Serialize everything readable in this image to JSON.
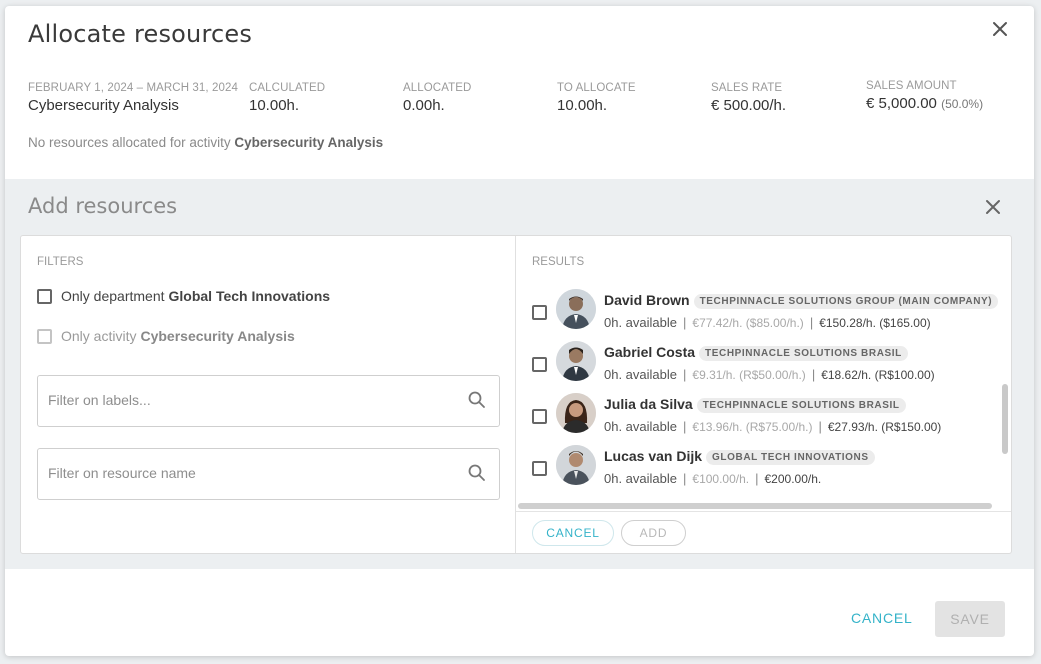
{
  "dialog": {
    "title": "Allocate resources",
    "summary": {
      "period": {
        "label": "FEBRUARY 1, 2024 – MARCH 31, 2024",
        "value": "Cybersecurity Analysis"
      },
      "calculated": {
        "label": "CALCULATED",
        "value": "10.00h."
      },
      "allocated": {
        "label": "ALLOCATED",
        "value": "0.00h."
      },
      "to_allocate": {
        "label": "TO ALLOCATE",
        "value": "10.00h."
      },
      "sales_rate": {
        "label": "SALES RATE",
        "value": "€ 500.00/h."
      },
      "sales_amount": {
        "label": "SALES AMOUNT",
        "value": "€ 5,000.00",
        "pct": "(50.0%)"
      }
    },
    "no_resources_prefix": "No resources allocated for activity",
    "no_resources_activity": "Cybersecurity Analysis",
    "footer": {
      "cancel_label": "CANCEL",
      "save_label": "SAVE"
    }
  },
  "add_resources": {
    "title": "Add resources",
    "filters": {
      "label": "FILTERS",
      "only_department": {
        "prefix": "Only department",
        "value": "Global Tech Innovations",
        "checked": false
      },
      "only_activity": {
        "prefix": "Only activity",
        "value": "Cybersecurity Analysis",
        "checked": false,
        "disabled": true
      },
      "labels_placeholder": "Filter on labels...",
      "name_placeholder": "Filter on resource name"
    },
    "results": {
      "label": "RESULTS",
      "items": [
        {
          "name": "David Brown",
          "company": "TECHPINNACLE SOLUTIONS GROUP (MAIN COMPANY)",
          "available": "0h. available",
          "cost": "€77.42/h. ($85.00/h.)",
          "price": "€150.28/h. ($165.00)",
          "avatar_color": "#5a6b7a"
        },
        {
          "name": "Gabriel Costa",
          "company": "TECHPINNACLE SOLUTIONS BRASIL",
          "available": "0h. available",
          "cost": "€9.31/h. (R$50.00/h.)",
          "price": "€18.62/h. (R$100.00)",
          "avatar_color": "#3e4a56"
        },
        {
          "name": "Julia da Silva",
          "company": "TECHPINNACLE SOLUTIONS BRASIL",
          "available": "0h. available",
          "cost": "€13.96/h. (R$75.00/h.)",
          "price": "€27.93/h. (R$150.00)",
          "avatar_color": "#6b4a3a"
        },
        {
          "name": "Lucas van Dijk",
          "company": "GLOBAL TECH INNOVATIONS",
          "available": "0h. available",
          "cost": "€100.00/h.",
          "price": "€200.00/h.",
          "avatar_color": "#4e5560"
        }
      ]
    },
    "cancel_label": "CANCEL",
    "add_label": "ADD"
  },
  "colors": {
    "accent": "#35b3c9",
    "section_bg": "#eceff1"
  }
}
